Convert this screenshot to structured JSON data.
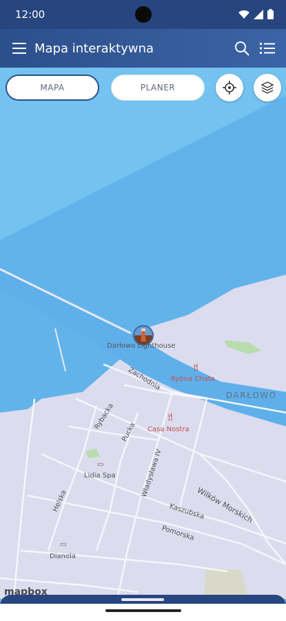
{
  "status_bar": {
    "time": "12:00"
  },
  "app_bar": {
    "title": "Mapa interaktywna"
  },
  "tabs": [
    {
      "label": "MAPA",
      "active": true
    },
    {
      "label": "PLANER",
      "active": false
    }
  ],
  "map": {
    "markers": [
      {
        "label": "Darłowo Lighthouse",
        "type": "lighthouse"
      },
      {
        "label": "Rybna Chata",
        "type": "restaurant"
      },
      {
        "label": "Casa Nostra",
        "type": "restaurant"
      },
      {
        "label": "Lidia Spa",
        "type": "hotel"
      },
      {
        "label": "Dianola",
        "type": "hotel"
      }
    ],
    "streets": [
      "Zachodnia",
      "Rybacka",
      "Pucka",
      "Władysława IV",
      "Wilków Morskich",
      "Kaszubska",
      "Pomorska",
      "Helska"
    ],
    "town_label": "DARŁOWO",
    "attribution": "mapbox"
  },
  "colors": {
    "primary": "#2c4f8c",
    "water": "#6db7ea",
    "land": "#dcdcef",
    "poi": "#c0504d"
  }
}
